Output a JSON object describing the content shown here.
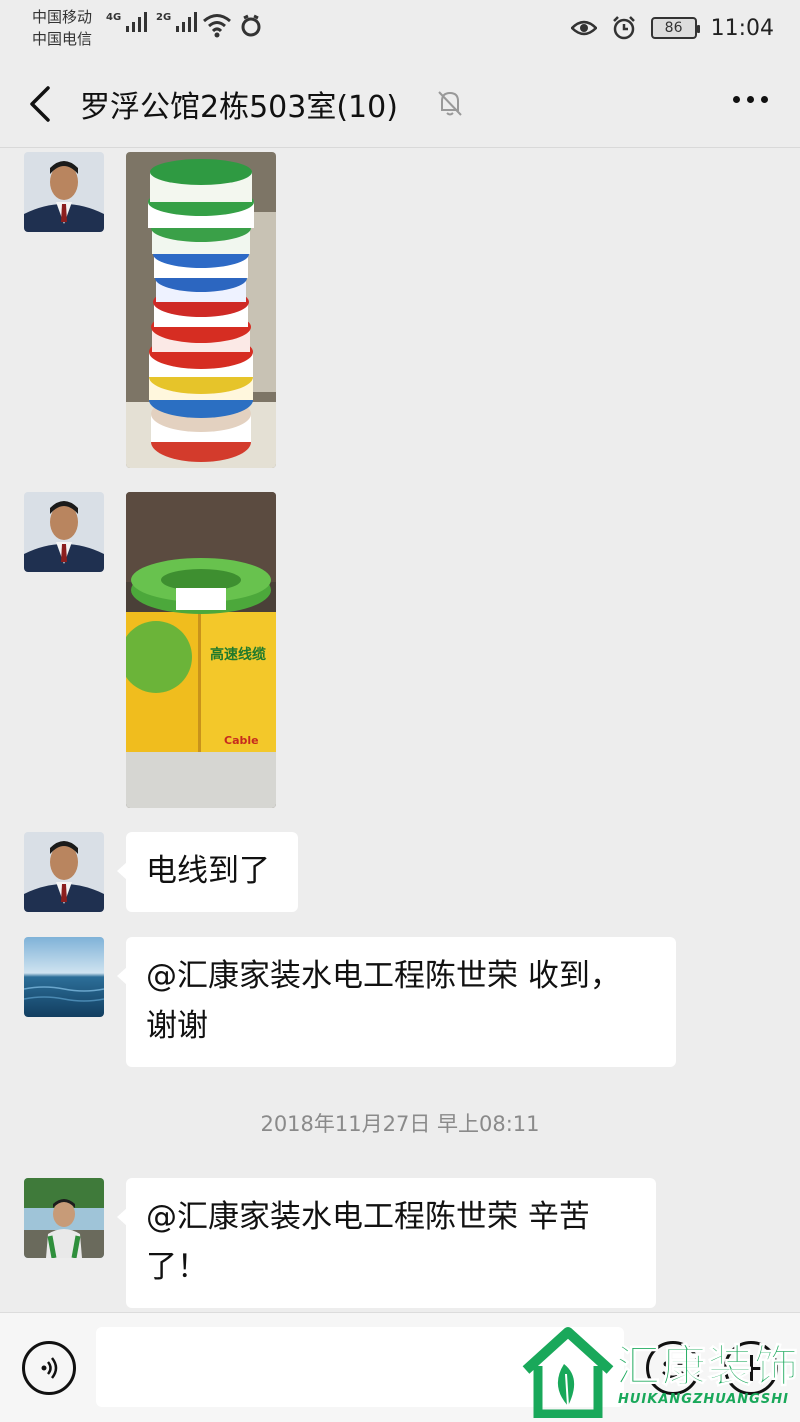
{
  "status_bar": {
    "carrier_1": "中国移动",
    "carrier_2": "中国电信",
    "sim1_network": "4G",
    "sim2_network": "2G",
    "battery": "86",
    "time": "11:04"
  },
  "header": {
    "title": "罗浮公馆2栋503室(10)"
  },
  "messages": {
    "m3_text": "电线到了",
    "m4_line1": "@汇康家装水电工程陈世荣  收到，",
    "m4_line2": "谢谢",
    "timestamp": "2018年11月27日 早上08:11",
    "m5_line1": "@汇康家装水电工程陈世荣  辛苦",
    "m5_line2": "了！"
  },
  "photo_texts": {
    "box_title": "高速线缆",
    "box_brand": "Cable"
  },
  "input_bar": {
    "placeholder": ""
  },
  "watermark": {
    "brand": "汇康装饰",
    "pinyin": "HUIKANGZHUANGSHI"
  },
  "colors": {
    "background": "#ededed",
    "bubble": "#ffffff",
    "watermark_green": "#19a85a"
  }
}
